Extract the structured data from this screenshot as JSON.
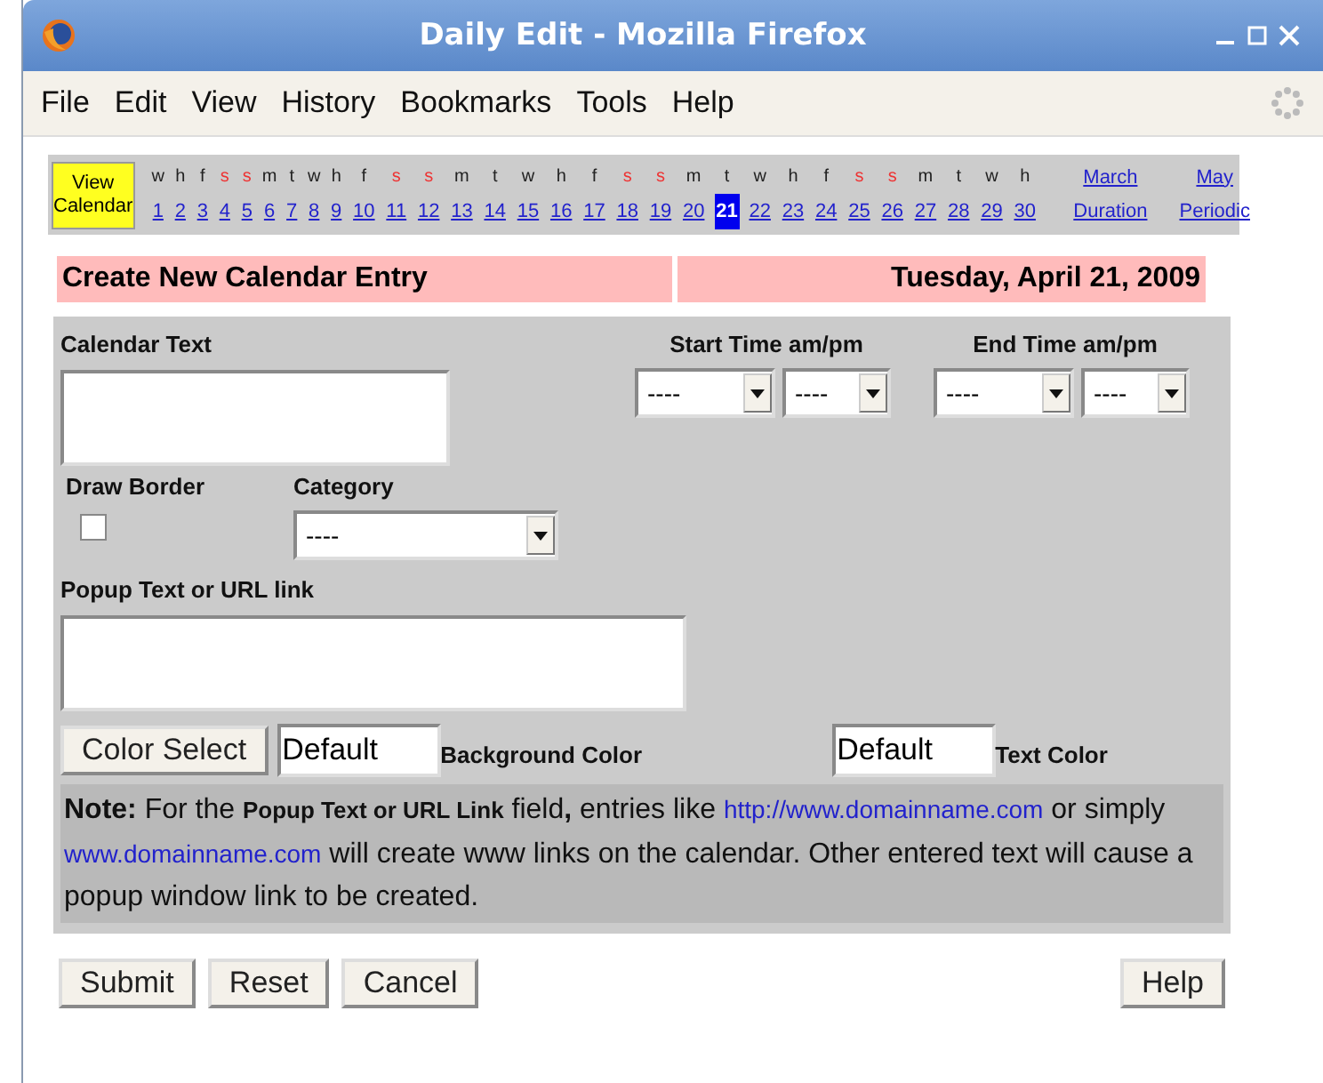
{
  "window": {
    "title": "Daily Edit - Mozilla Firefox"
  },
  "menu": [
    "File",
    "Edit",
    "View",
    "History",
    "Bookmarks",
    "Tools",
    "Help"
  ],
  "calendar_strip": {
    "view_button": "View Calendar",
    "days": [
      {
        "letter": "w",
        "number": "1",
        "weekend": false,
        "selected": false
      },
      {
        "letter": "h",
        "number": "2",
        "weekend": false,
        "selected": false
      },
      {
        "letter": "f",
        "number": "3",
        "weekend": false,
        "selected": false
      },
      {
        "letter": "s",
        "number": "4",
        "weekend": true,
        "selected": false
      },
      {
        "letter": "s",
        "number": "5",
        "weekend": true,
        "selected": false
      },
      {
        "letter": "m",
        "number": "6",
        "weekend": false,
        "selected": false
      },
      {
        "letter": "t",
        "number": "7",
        "weekend": false,
        "selected": false
      },
      {
        "letter": "w",
        "number": "8",
        "weekend": false,
        "selected": false
      },
      {
        "letter": "h",
        "number": "9",
        "weekend": false,
        "selected": false
      },
      {
        "letter": "f",
        "number": "10",
        "weekend": false,
        "selected": false
      },
      {
        "letter": "s",
        "number": "11",
        "weekend": true,
        "selected": false
      },
      {
        "letter": "s",
        "number": "12",
        "weekend": true,
        "selected": false
      },
      {
        "letter": "m",
        "number": "13",
        "weekend": false,
        "selected": false
      },
      {
        "letter": "t",
        "number": "14",
        "weekend": false,
        "selected": false
      },
      {
        "letter": "w",
        "number": "15",
        "weekend": false,
        "selected": false
      },
      {
        "letter": "h",
        "number": "16",
        "weekend": false,
        "selected": false
      },
      {
        "letter": "f",
        "number": "17",
        "weekend": false,
        "selected": false
      },
      {
        "letter": "s",
        "number": "18",
        "weekend": true,
        "selected": false
      },
      {
        "letter": "s",
        "number": "19",
        "weekend": true,
        "selected": false
      },
      {
        "letter": "m",
        "number": "20",
        "weekend": false,
        "selected": false
      },
      {
        "letter": "t",
        "number": "21",
        "weekend": false,
        "selected": true
      },
      {
        "letter": "w",
        "number": "22",
        "weekend": false,
        "selected": false
      },
      {
        "letter": "h",
        "number": "23",
        "weekend": false,
        "selected": false
      },
      {
        "letter": "f",
        "number": "24",
        "weekend": false,
        "selected": false
      },
      {
        "letter": "s",
        "number": "25",
        "weekend": true,
        "selected": false
      },
      {
        "letter": "s",
        "number": "26",
        "weekend": true,
        "selected": false
      },
      {
        "letter": "m",
        "number": "27",
        "weekend": false,
        "selected": false
      },
      {
        "letter": "t",
        "number": "28",
        "weekend": false,
        "selected": false
      },
      {
        "letter": "w",
        "number": "29",
        "weekend": false,
        "selected": false
      },
      {
        "letter": "h",
        "number": "30",
        "weekend": false,
        "selected": false
      }
    ],
    "links": [
      [
        "March",
        "Duration"
      ],
      [
        "May",
        "Periodic"
      ]
    ]
  },
  "header": {
    "title": "Create New Calendar Entry",
    "date": "Tuesday, April 21, 2009"
  },
  "form": {
    "calendar_text_label": "Calendar Text",
    "start_time": {
      "label": "Start Time am/pm",
      "selects": [
        "----",
        "----"
      ]
    },
    "end_time": {
      "label": "End Time am/pm",
      "selects": [
        "----",
        "----"
      ]
    },
    "draw_border": {
      "label": "Draw Border",
      "checked": false
    },
    "category": {
      "label": "Category",
      "value": "----"
    },
    "popup_label": "Popup Text or URL link",
    "color_button": "Color Select",
    "background_color": {
      "value": "Default",
      "label": "Background Color"
    },
    "text_color": {
      "value": "Default",
      "label": "Text Color"
    },
    "note": [
      {
        "kind": "bold",
        "text": "Note:"
      },
      {
        "kind": "text",
        "text": " For the "
      },
      {
        "kind": "small-bold",
        "text": "Popup Text or URL Link"
      },
      {
        "kind": "text",
        "text": " field"
      },
      {
        "kind": "bold",
        "text": ","
      },
      {
        "kind": "text",
        "text": " entries like "
      },
      {
        "kind": "link",
        "text": "http://www.domainname.com"
      },
      {
        "kind": "text",
        "text": " or simply "
      },
      {
        "kind": "link",
        "text": "www.domainname.com"
      },
      {
        "kind": "text",
        "text": " will create www links on the calendar. Other entered text will cause a popup window link to be created."
      }
    ]
  },
  "buttons": [
    "Submit",
    "Reset",
    "Cancel"
  ],
  "help_button": "Help"
}
